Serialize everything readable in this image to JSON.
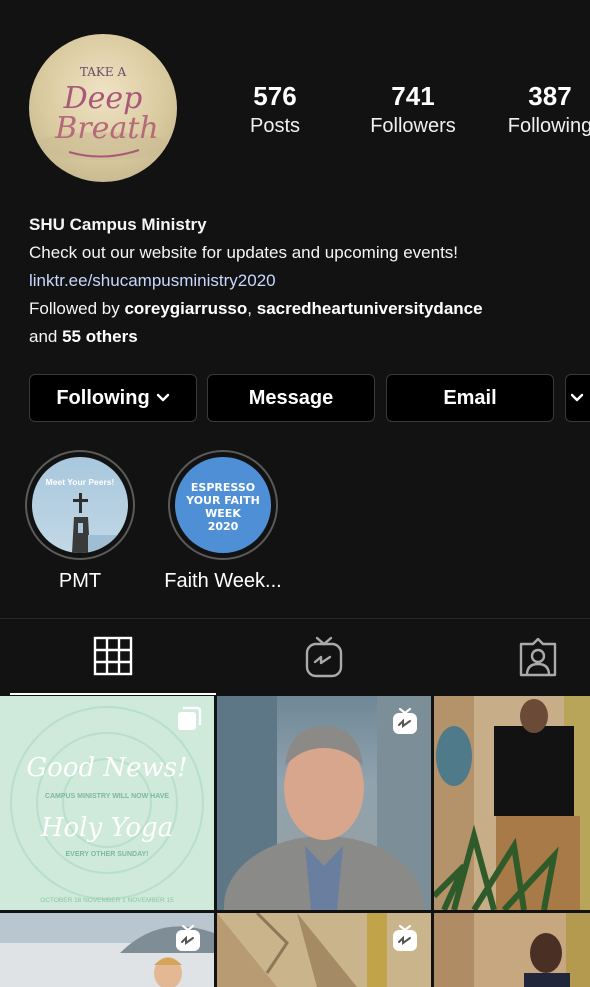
{
  "profile": {
    "avatar_text": [
      "TAKE A",
      "Deep",
      "Breath"
    ],
    "stats": [
      {
        "value": "576",
        "label": "Posts"
      },
      {
        "value": "741",
        "label": "Followers"
      },
      {
        "value": "387",
        "label": "Following"
      }
    ],
    "name": "SHU Campus Ministry",
    "bio": "Check out our website for updates and upcoming events!",
    "link": "linktr.ee/shucampusministry2020",
    "followed_by_prefix": "Followed by ",
    "followed_user_1": "coreygiarrusso",
    "followed_sep": ", ",
    "followed_user_2": "sacredheartuniversitydance",
    "followed_and": "and ",
    "followed_others": "55 others"
  },
  "actions": {
    "following": "Following",
    "message": "Message",
    "email": "Email"
  },
  "highlights": [
    {
      "label": "PMT",
      "cover_text": "Meet Your Peers!"
    },
    {
      "label": "Faith Week...",
      "cover_text": [
        "ESPRESSO",
        "YOUR FAITH",
        "WEEK",
        "2020"
      ]
    }
  ],
  "tabs": [
    "grid-icon",
    "igtv-icon",
    "tagged-icon"
  ],
  "posts": {
    "yoga": {
      "title1": "Good News!",
      "subtitle": "CAMPUS MINISTRY WILL NOW HAVE",
      "title2": "Holy Yoga",
      "note": "EVERY OTHER SUNDAY!",
      "dates": "OCTOBER 18 NOVEMBER 1 NOVEMBER 15"
    }
  },
  "colors": {
    "background": "#121212",
    "button_bg": "#000000",
    "link": "#c9d7ff",
    "faith_week_blue": "#4e8fd6"
  }
}
